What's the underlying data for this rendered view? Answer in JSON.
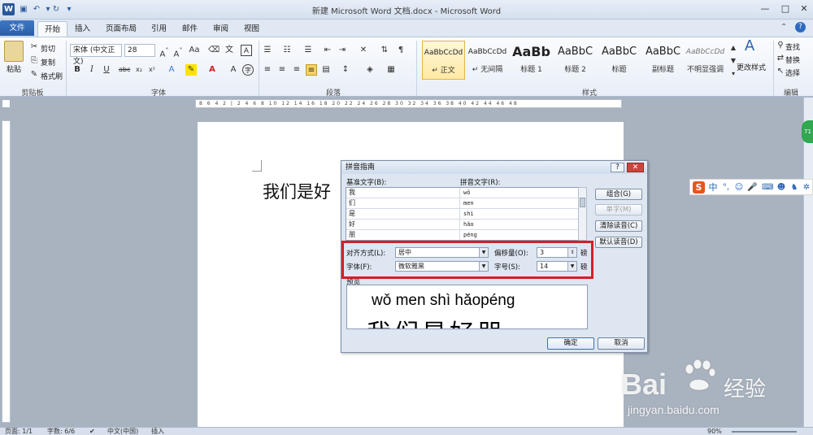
{
  "window": {
    "title": "新建 Microsoft Word 文档.docx - Microsoft Word",
    "app_icon": "W",
    "minimize": "—",
    "maximize": "□",
    "close": "✕"
  },
  "tabs": [
    "文件",
    "开始",
    "插入",
    "页面布局",
    "引用",
    "邮件",
    "审阅",
    "视图"
  ],
  "ribbon": {
    "clipboard": {
      "paste": "粘贴",
      "cut": "剪切",
      "copy": "复制",
      "format_painter": "格式刷",
      "label": "剪贴板"
    },
    "font": {
      "font_name": "宋体 (中文正文)",
      "font_size": "28",
      "label": "字体"
    },
    "paragraph": {
      "label": "段落"
    },
    "styles": {
      "items": [
        {
          "sample": "AaBbCcDd",
          "name": "↵ 正文"
        },
        {
          "sample": "AaBbCcDd",
          "name": "↵ 无间隔"
        },
        {
          "sample": "AaBb",
          "name": "标题 1"
        },
        {
          "sample": "AaBbC",
          "name": "标题 2"
        },
        {
          "sample": "AaBbC",
          "name": "标题"
        },
        {
          "sample": "AaBbC",
          "name": "副标题"
        },
        {
          "sample": "AaBbCcDd",
          "name": "不明显强调"
        }
      ],
      "change_styles": "更改样式",
      "label": "样式"
    },
    "editing": {
      "find": "查找",
      "replace": "替换",
      "select": "选择",
      "label": "编辑"
    }
  },
  "ruler_ticks": "8 6 4 2 | 2 4 6 8 10 12 14 16 18 20 22 24 26 28 30 32 34 36 38 40 42 44 46 48",
  "document": {
    "text": "我们是好"
  },
  "dialog": {
    "title": "拼音指南",
    "help": "?",
    "close": "✕",
    "base_text_label": "基准文字(B):",
    "pinyin_text_label": "拼音文字(R):",
    "rows": [
      {
        "base": "我",
        "pinyin": "wǒ"
      },
      {
        "base": "们",
        "pinyin": "men"
      },
      {
        "base": "是",
        "pinyin": "shì"
      },
      {
        "base": "好",
        "pinyin": "hǎo"
      },
      {
        "base": "朋",
        "pinyin": "péng"
      }
    ],
    "buttons": {
      "combine": "组合(G)",
      "single": "单字(M)",
      "clear": "清除读音(C)",
      "default": "默认读音(D)",
      "ok": "确定",
      "cancel": "取消"
    },
    "align_label": "对齐方式(L):",
    "align_value": "居中",
    "offset_label": "偏移量(O):",
    "offset_value": "3",
    "offset_unit": "磅",
    "font_label": "字体(F):",
    "font_value": "微软雅黑",
    "size_label": "字号(S):",
    "size_value": "14",
    "size_unit": "磅",
    "preview_label": "预览",
    "preview_pinyin": "wǒ men shì hǎopéng",
    "preview_hanzi": "我们是好朋"
  },
  "ime": {
    "logo": "S",
    "mode": "中"
  },
  "status_bar": {
    "page": "页面: 1/1",
    "words": "字数: 6/6",
    "language": "中文(中国)",
    "insert": "插入",
    "zoom": "90%"
  },
  "watermark": {
    "brand": "Bai",
    "brand_cn": "经验",
    "url": "jingyan.baidu.com"
  },
  "colors": {
    "file_tab": "#2b5ea8",
    "highlight": "#d32027",
    "ime_logo": "#e8541e"
  }
}
